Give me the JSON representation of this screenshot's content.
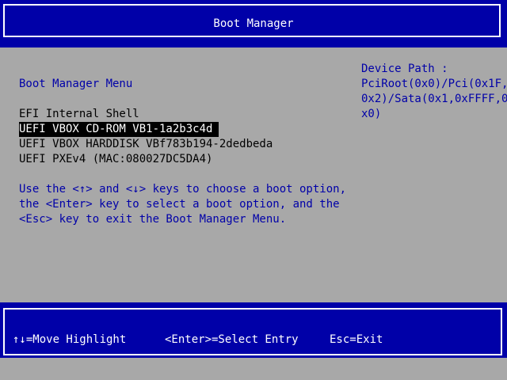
{
  "header": {
    "title": "Boot Manager"
  },
  "menu": {
    "title": "Boot Manager Menu",
    "options": [
      {
        "label": "EFI Internal Shell",
        "selected": false
      },
      {
        "label": "UEFI VBOX CD-ROM VB1-1a2b3c4d",
        "selected": true
      },
      {
        "label": "UEFI VBOX HARDDISK VBf783b194-2dedbeda",
        "selected": false
      },
      {
        "label": "UEFI PXEv4 (MAC:080027DC5DA4)",
        "selected": false
      }
    ],
    "help_lines": [
      "Use the <↑> and <↓> keys to choose a boot option,",
      "the <Enter> key to select a boot option, and the",
      "<Esc> key to exit the Boot Manager Menu."
    ]
  },
  "device": {
    "label": "Device Path :",
    "path_lines": [
      "PciRoot(0x0)/Pci(0x1F,",
      "0x2)/Sata(0x1,0xFFFF,0",
      "x0)"
    ]
  },
  "footer": {
    "move_highlight": "↑↓=Move Highlight",
    "select_entry": "<Enter>=Select Entry",
    "exit": "Esc=Exit"
  },
  "colors": {
    "background_blue": "#0000a8",
    "panel_gray": "#a8a8a8",
    "text_white": "#ffffff",
    "text_black": "#000000"
  }
}
